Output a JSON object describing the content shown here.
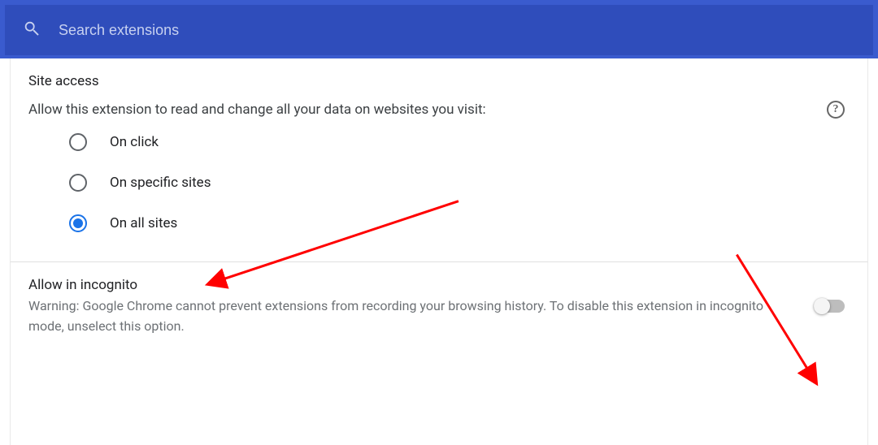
{
  "search": {
    "placeholder": "Search extensions"
  },
  "siteAccess": {
    "title": "Site access",
    "description": "Allow this extension to read and change all your data on websites you visit:",
    "options": [
      {
        "label": "On click",
        "selected": false
      },
      {
        "label": "On specific sites",
        "selected": false
      },
      {
        "label": "On all sites",
        "selected": true
      }
    ]
  },
  "incognito": {
    "title": "Allow in incognito",
    "warning": "Warning: Google Chrome cannot prevent extensions from recording your browsing history. To disable this extension in incognito mode, unselect this option.",
    "enabled": false
  }
}
